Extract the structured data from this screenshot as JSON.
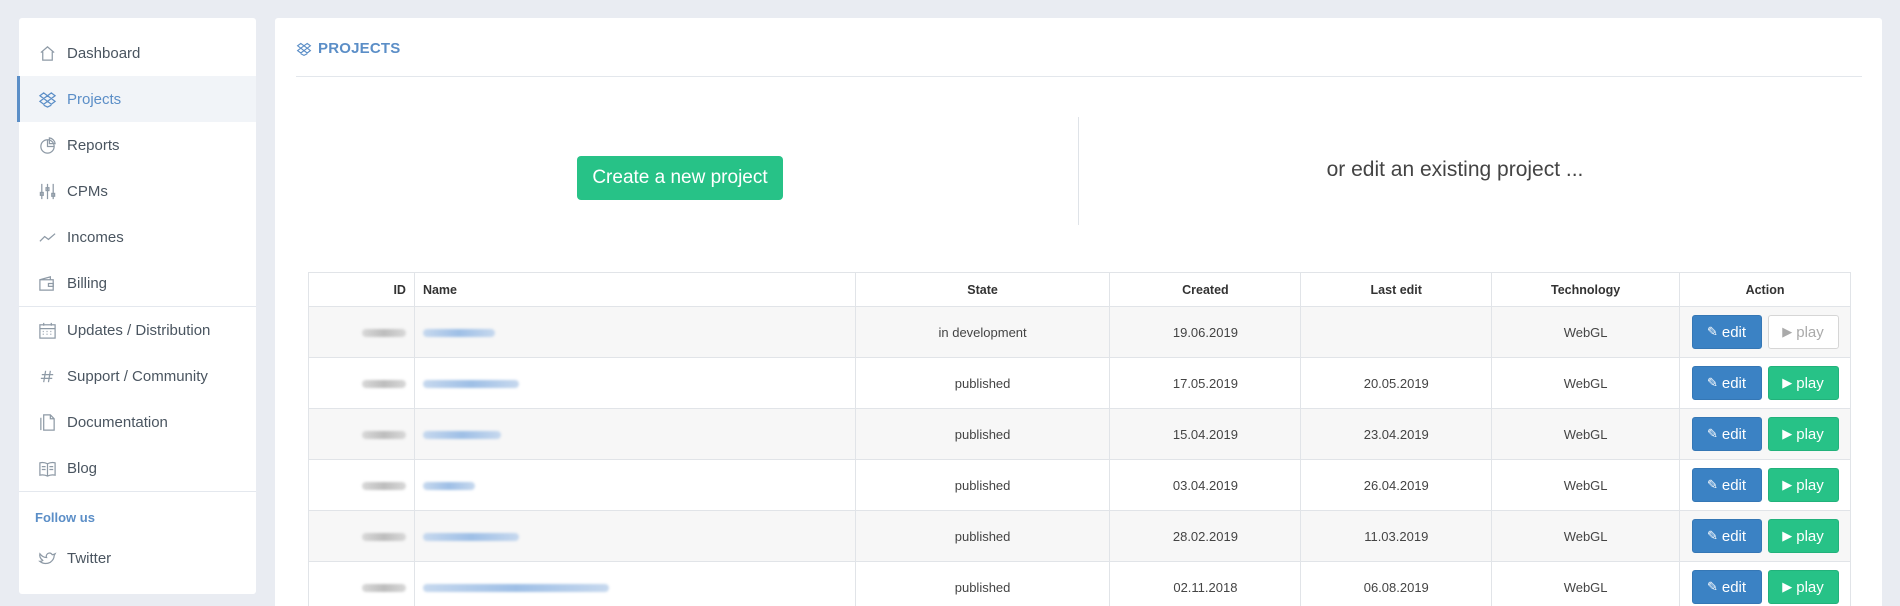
{
  "sidebar": {
    "items": [
      {
        "label": "Dashboard",
        "icon": "home-icon"
      },
      {
        "label": "Projects",
        "icon": "dropbox-icon"
      },
      {
        "label": "Reports",
        "icon": "pie-chart-icon"
      },
      {
        "label": "CPMs",
        "icon": "sliders-icon"
      },
      {
        "label": "Incomes",
        "icon": "trend-line-icon"
      },
      {
        "label": "Billing",
        "icon": "wallet-icon"
      },
      {
        "label": "Updates / Distribution",
        "icon": "calendar-icon"
      },
      {
        "label": "Support / Community",
        "icon": "hashtag-icon"
      },
      {
        "label": "Documentation",
        "icon": "documents-icon"
      },
      {
        "label": "Blog",
        "icon": "book-icon"
      }
    ],
    "follow_label": "Follow us",
    "social": {
      "label": "Twitter",
      "icon": "twitter-icon"
    }
  },
  "panel": {
    "title": "PROJECTS",
    "create_button": "Create a new project",
    "or_text": "or edit an existing project ..."
  },
  "table": {
    "headers": {
      "id": "ID",
      "name": "Name",
      "state": "State",
      "created": "Created",
      "last_edit": "Last edit",
      "technology": "Technology",
      "action": "Action"
    },
    "rows": [
      {
        "state": "in development",
        "created": "19.06.2019",
        "last_edit": "",
        "technology": "WebGL",
        "edit": "edit",
        "play": "play",
        "play_enabled": false
      },
      {
        "state": "published",
        "created": "17.05.2019",
        "last_edit": "20.05.2019",
        "technology": "WebGL",
        "edit": "edit",
        "play": "play",
        "play_enabled": true
      },
      {
        "state": "published",
        "created": "15.04.2019",
        "last_edit": "23.04.2019",
        "technology": "WebGL",
        "edit": "edit",
        "play": "play",
        "play_enabled": true
      },
      {
        "state": "published",
        "created": "03.04.2019",
        "last_edit": "26.04.2019",
        "technology": "WebGL",
        "edit": "edit",
        "play": "play",
        "play_enabled": true
      },
      {
        "state": "published",
        "created": "28.02.2019",
        "last_edit": "11.03.2019",
        "technology": "WebGL",
        "edit": "edit",
        "play": "play",
        "play_enabled": true
      },
      {
        "state": "published",
        "created": "02.11.2018",
        "last_edit": "06.08.2019",
        "technology": "WebGL",
        "edit": "edit",
        "play": "play",
        "play_enabled": true
      }
    ]
  },
  "colors": {
    "accent": "#5b8ec7",
    "create": "#27c287",
    "edit": "#3b82c4",
    "play": "#27c287",
    "background": "#e9ecf2"
  }
}
